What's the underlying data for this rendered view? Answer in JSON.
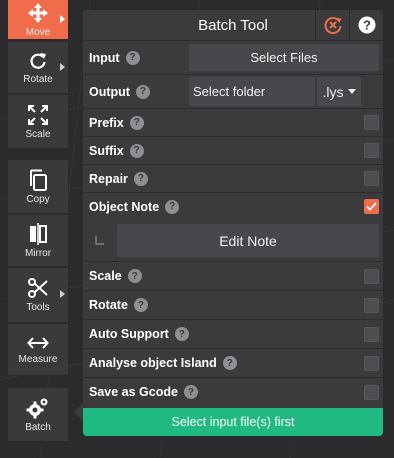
{
  "toolbar": {
    "tools": [
      {
        "label": "Move",
        "icon": "move-icon"
      },
      {
        "label": "Rotate",
        "icon": "rotate-icon"
      },
      {
        "label": "Scale",
        "icon": "scale-icon"
      },
      {
        "label": "Copy",
        "icon": "copy-icon"
      },
      {
        "label": "Mirror",
        "icon": "mirror-icon"
      },
      {
        "label": "Tools",
        "icon": "scissors-icon"
      },
      {
        "label": "Measure",
        "icon": "measure-icon"
      },
      {
        "label": "Batch",
        "icon": "gears-icon"
      }
    ]
  },
  "panel": {
    "title": "Batch Tool",
    "input": {
      "label": "Input",
      "button": "Select Files"
    },
    "output": {
      "label": "Output",
      "button": "Select folder",
      "extension": ".lys"
    },
    "options": {
      "prefix": "Prefix",
      "suffix": "Suffix",
      "repair": "Repair",
      "object_note": "Object Note",
      "edit_note": "Edit Note",
      "scale": "Scale",
      "rotate": "Rotate",
      "auto_support": "Auto Support",
      "analyse_island": "Analyse object Island",
      "save_gcode": "Save as Gcode"
    },
    "help_glyph": "?",
    "action_button": "Select input file(s) first"
  },
  "colors": {
    "accent": "#ef6d4b",
    "go": "#1fb981",
    "panel": "#3b3b3e"
  }
}
